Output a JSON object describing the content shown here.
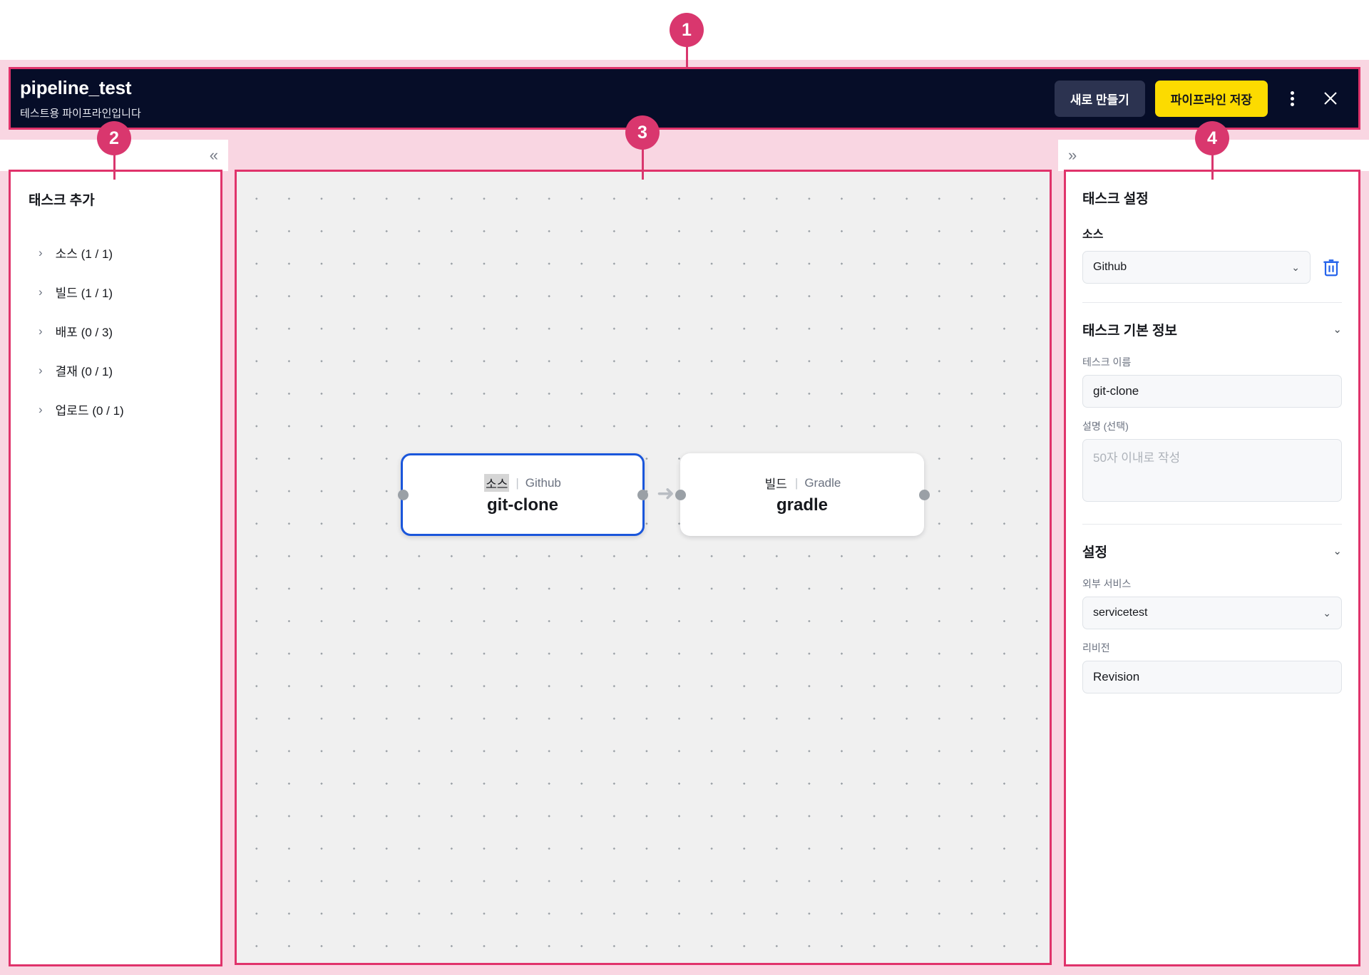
{
  "header": {
    "title": "pipeline_test",
    "subtitle": "테스트용 파이프라인입니다",
    "new_button": "새로 만들기",
    "save_button": "파이프라인 저장",
    "kebab_icon": "kebab-menu-icon",
    "close_icon": "close-icon"
  },
  "toolstrip": {
    "collapse_left_icon": "«",
    "expand_right_icon": "»"
  },
  "sidebar": {
    "heading": "태스크 추가",
    "caret": "›",
    "items": [
      {
        "label": "소스 (1 / 1)"
      },
      {
        "label": "빌드 (1 / 1)"
      },
      {
        "label": "배포 (0 / 3)"
      },
      {
        "label": "결재 (0 / 1)"
      },
      {
        "label": "업로드 (0 / 1)"
      }
    ]
  },
  "canvas": {
    "arrow_glyph": "➜",
    "nodes": [
      {
        "kind": "소스",
        "separator": "|",
        "provider": "Github",
        "name": "git-clone",
        "selected": true
      },
      {
        "kind": "빌드",
        "separator": "|",
        "provider": "Gradle",
        "name": "gradle",
        "selected": false
      }
    ]
  },
  "right_panel": {
    "heading": "태스크 설정",
    "source": {
      "label": "소스",
      "value": "Github",
      "caret": "⌄",
      "delete_icon": "trash-icon"
    },
    "basic_info": {
      "title": "태스크 기본 정보",
      "caret": "⌄",
      "name_label": "테스크 이름",
      "name_value": "git-clone",
      "desc_label": "설명 (선택)",
      "desc_value": "",
      "desc_placeholder": "50자 이내로 작성"
    },
    "settings": {
      "title": "설정",
      "caret": "⌄",
      "service_label": "외부 서비스",
      "service_value": "servicetest",
      "service_caret": "⌄",
      "revision_label": "리비전",
      "revision_value": "Revision"
    }
  },
  "annotations": [
    {
      "number": "1"
    },
    {
      "number": "2"
    },
    {
      "number": "3"
    },
    {
      "number": "4"
    }
  ],
  "colors": {
    "accent_pink": "#d9376e",
    "highlight_fill": "#f9d6e2",
    "header_dark": "#060d28",
    "primary_yellow": "#fcdb00",
    "node_selected_blue": "#1a56db"
  }
}
